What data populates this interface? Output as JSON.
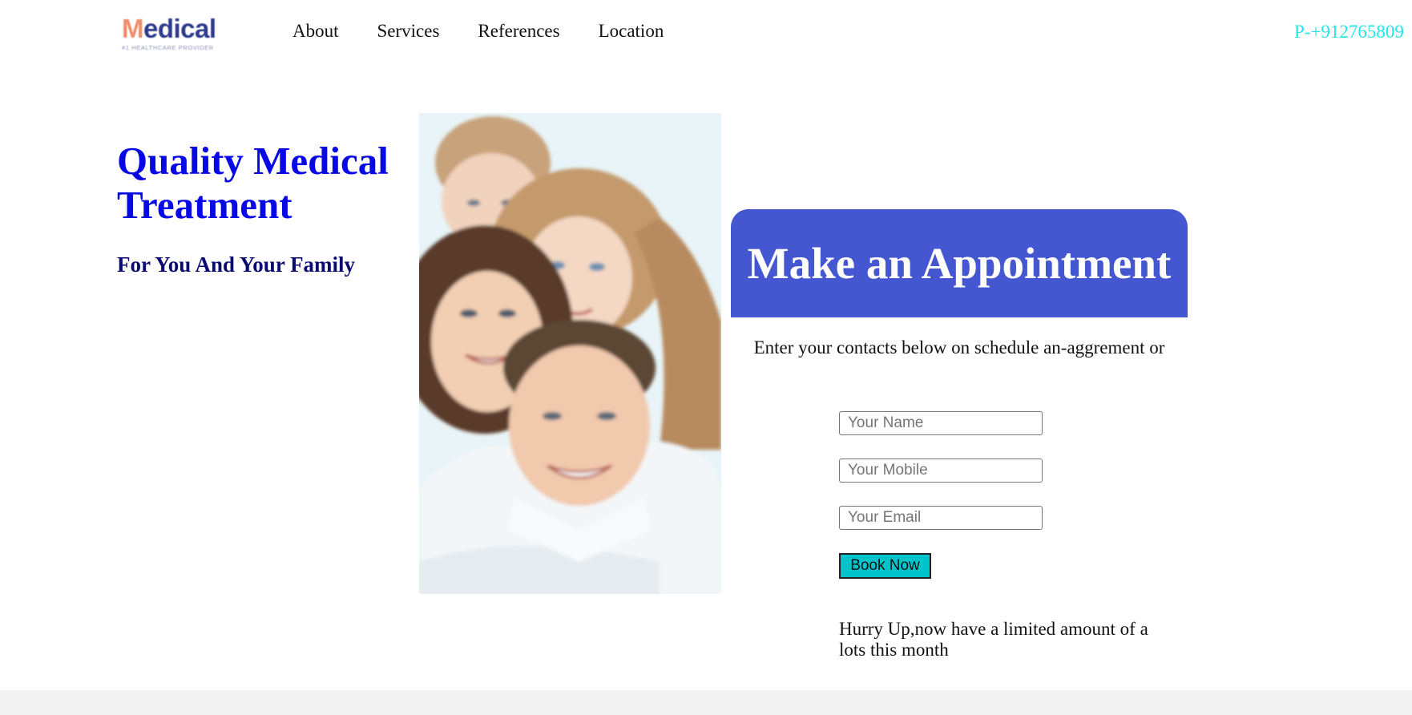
{
  "header": {
    "logo": {
      "text_m": "M",
      "text_rest": "edical",
      "tagline": "#1 HEALTHCARE PROVIDER"
    },
    "nav": [
      {
        "label": "About"
      },
      {
        "label": "Services"
      },
      {
        "label": "References"
      },
      {
        "label": "Location"
      }
    ],
    "phone": "P-+912765809"
  },
  "hero": {
    "title": "Quality Medical Treatment",
    "subtitle": "For You And Your Family",
    "photo_icon": "family-photo"
  },
  "appointment": {
    "title": "Make an Appointment",
    "description": "Enter your contacts below on schedule an-aggrement or",
    "fields": {
      "name_placeholder": "Your Name",
      "mobile_placeholder": "Your Mobile",
      "email_placeholder": "Your Email"
    },
    "button_label": "Book Now",
    "hurry_text": "Hurry Up,now have a limited amount of a lots this month"
  },
  "colors": {
    "accent_blue": "#4457d0",
    "title_blue": "#0808e6",
    "subtitle_navy": "#0a0a72",
    "phone_cyan": "#22e6e6",
    "button_cyan": "#00c4cc",
    "logo_orange": "#f08d6a",
    "logo_navy": "#2e3a8c"
  }
}
